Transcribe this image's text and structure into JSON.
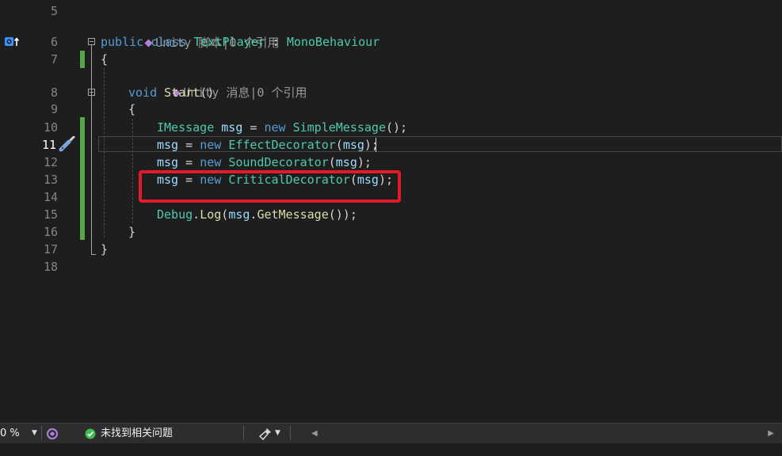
{
  "lens_script": "Unity 脚本|0 个引用",
  "lens_message": "Unity 消息|0 个引用",
  "lines": [
    {
      "n": "5"
    },
    {
      "n": "6"
    },
    {
      "n": "7"
    },
    {
      "n": "8"
    },
    {
      "n": "9"
    },
    {
      "n": "10"
    },
    {
      "n": "11"
    },
    {
      "n": "12"
    },
    {
      "n": "13"
    },
    {
      "n": "14"
    },
    {
      "n": "15"
    },
    {
      "n": "16"
    },
    {
      "n": "17"
    },
    {
      "n": "18"
    }
  ],
  "code": {
    "l6": {
      "public": "public",
      "class": "class",
      "name": "TextPlayer",
      "colon": " : ",
      "base": "MonoBehaviour"
    },
    "l7": "{",
    "l8": {
      "void": "void",
      "method": "Start",
      "parens": "()"
    },
    "l9": "{",
    "l10": {
      "type": "IMessage",
      "var": "msg",
      "eq": " = ",
      "new": "new",
      "ctor": "SimpleMessage",
      "tail": "();"
    },
    "l11": {
      "var": "msg",
      "eq": " = ",
      "new": "new",
      "ctor": "EffectDecorator",
      "open": "(",
      "arg": "msg",
      "tail": ");"
    },
    "l12": {
      "var": "msg",
      "eq": " = ",
      "new": "new",
      "ctor": "SoundDecorator",
      "open": "(",
      "arg": "msg",
      "tail": ");"
    },
    "l13": {
      "var": "msg",
      "eq": " = ",
      "new": "new",
      "ctor": "CriticalDecorator",
      "open": "(",
      "arg": "msg",
      "tail": ");"
    },
    "l15": {
      "cls": "Debug",
      "dot": ".",
      "fn": "Log",
      "open": "(",
      "arg": "msg",
      "dot2": ".",
      "fn2": "GetMessage",
      "tail": "());"
    },
    "l16": "}",
    "l17": "}"
  },
  "status": {
    "zoom": "0 %",
    "issues": "未找到相关问题"
  },
  "colors": {
    "keyword": "#569cd6",
    "type": "#4ec9b0",
    "identifier": "#9cdcfe",
    "method": "#dcdcaa",
    "highlight_box": "#e21b2c",
    "change_bar": "#57a64a"
  }
}
